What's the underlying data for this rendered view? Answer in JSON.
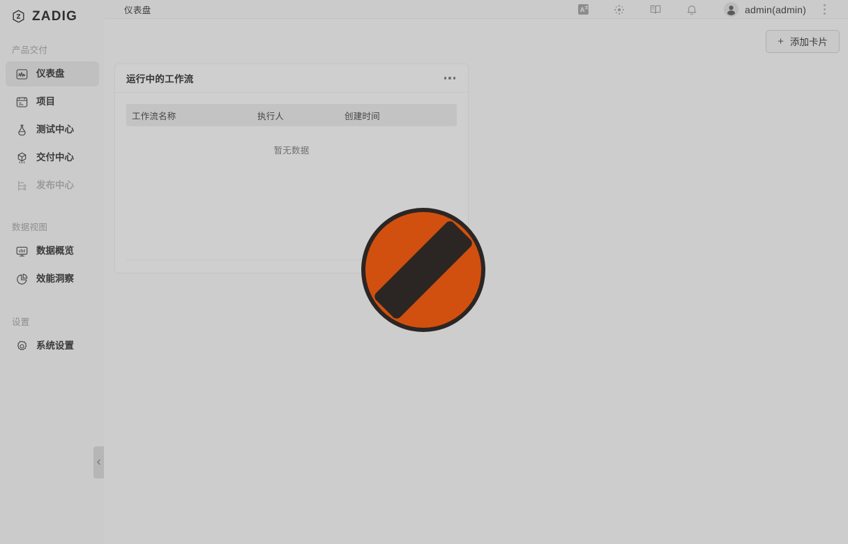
{
  "brand": {
    "name": "ZADIG",
    "logo_icon": "zadig-hexagon-logo"
  },
  "sidebar": {
    "groups": [
      {
        "label": "产品交付",
        "items": [
          {
            "label": "仪表盘",
            "icon": "dashboard-chart-icon",
            "active": true,
            "disabled": false
          },
          {
            "label": "项目",
            "icon": "project-board-icon",
            "active": false,
            "disabled": false
          },
          {
            "label": "测试中心",
            "icon": "test-flask-icon",
            "active": false,
            "disabled": false
          },
          {
            "label": "交付中心",
            "icon": "delivery-package-icon",
            "active": false,
            "disabled": false
          },
          {
            "label": "发布中心",
            "icon": "release-branch-icon",
            "active": false,
            "disabled": true
          }
        ]
      },
      {
        "label": "数据视图",
        "items": [
          {
            "label": "数据概览",
            "icon": "data-monitor-icon",
            "active": false,
            "disabled": false
          },
          {
            "label": "效能洞察",
            "icon": "pie-chart-icon",
            "active": false,
            "disabled": false
          }
        ]
      },
      {
        "label": "设置",
        "items": [
          {
            "label": "系统设置",
            "icon": "gear-icon",
            "active": false,
            "disabled": false
          }
        ]
      }
    ],
    "collapse_handle_icon": "chevron-left-icon"
  },
  "topbar": {
    "breadcrumb": "仪表盘",
    "actions": [
      {
        "name": "translate-icon",
        "icon": "translate-icon"
      },
      {
        "name": "ai-sparkle-icon",
        "icon": "ai-sparkle-icon"
      },
      {
        "name": "docs-book-icon",
        "icon": "docs-book-icon"
      },
      {
        "name": "bell-icon",
        "icon": "bell-icon"
      }
    ],
    "user": {
      "name": "admin(admin)",
      "avatar_icon": "user-avatar-icon"
    },
    "overflow_icon": "kebab-menu-icon"
  },
  "content": {
    "add_card_button": {
      "label": "添加卡片",
      "plus": "+"
    },
    "card": {
      "title": "运行中的工作流",
      "menu_icon": "ellipsis-menu-icon",
      "table": {
        "columns": [
          "工作流名称",
          "执行人",
          "创建时间"
        ],
        "rows": [],
        "empty_text": "暂无数据"
      }
    }
  },
  "overlay": {
    "cursor_icon": "no-entry-prohibited-cursor",
    "colors": {
      "fill": "#d2500f",
      "stroke": "#2b2624"
    }
  },
  "colors": {
    "app_background": "#cdcdcd",
    "sidebar_background": "#cbcbcb",
    "card_background": "#cfcfcf",
    "active_item": "#c0c0c0",
    "accent_orange": "#d2500f"
  }
}
